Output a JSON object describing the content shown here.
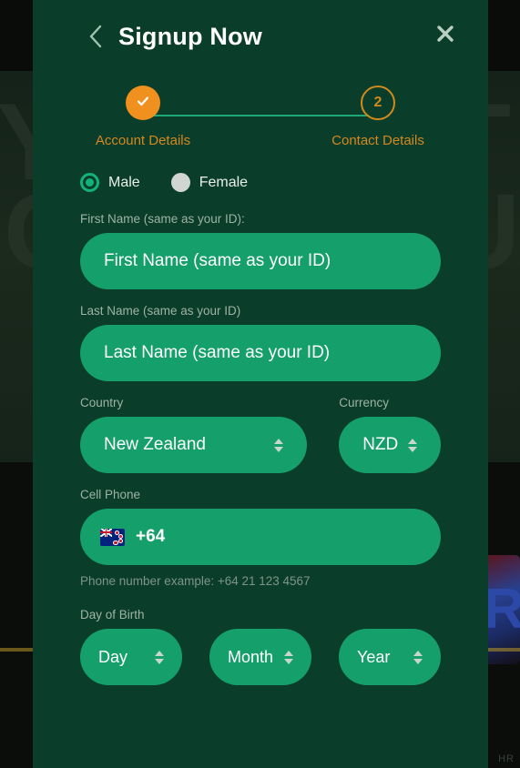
{
  "modal": {
    "title": "Signup Now",
    "back_icon": "chevron-left-icon",
    "close_icon": "close-icon"
  },
  "stepper": {
    "steps": [
      {
        "label": "Account Details",
        "indicator": "✓",
        "state": "completed"
      },
      {
        "label": "Contact Details",
        "indicator": "2",
        "state": "current"
      }
    ]
  },
  "gender": {
    "options": [
      {
        "label": "Male",
        "selected": true
      },
      {
        "label": "Female",
        "selected": false
      }
    ]
  },
  "first_name": {
    "label": "First Name (same as your ID):",
    "placeholder": "First Name (same as your ID)",
    "value": ""
  },
  "last_name": {
    "label": "Last Name (same as your ID)",
    "placeholder": "Last Name (same as your ID)",
    "value": ""
  },
  "country": {
    "label": "Country",
    "value": "New Zealand"
  },
  "currency": {
    "label": "Currency",
    "value": "NZD"
  },
  "cell_phone": {
    "label": "Cell Phone",
    "flag": "new-zealand-flag-icon",
    "dial_code": "+64",
    "value": "",
    "hint": "Phone number example: +64 21 123 4567"
  },
  "date_of_birth": {
    "label": "Day of Birth",
    "day": {
      "value": "Day"
    },
    "month": {
      "value": "Month"
    },
    "year": {
      "value": "Year"
    }
  },
  "background": {
    "ghost_letters": [
      "Y",
      "C",
      "T",
      "U"
    ],
    "footer_text": "HR"
  },
  "colors": {
    "modal_bg": "#0a3d2a",
    "input_bg": "#15a06b",
    "accent_orange": "#f0901f",
    "step_label": "#d4881f",
    "line_green": "#1fa87a",
    "label_muted": "#9eb3a5"
  }
}
